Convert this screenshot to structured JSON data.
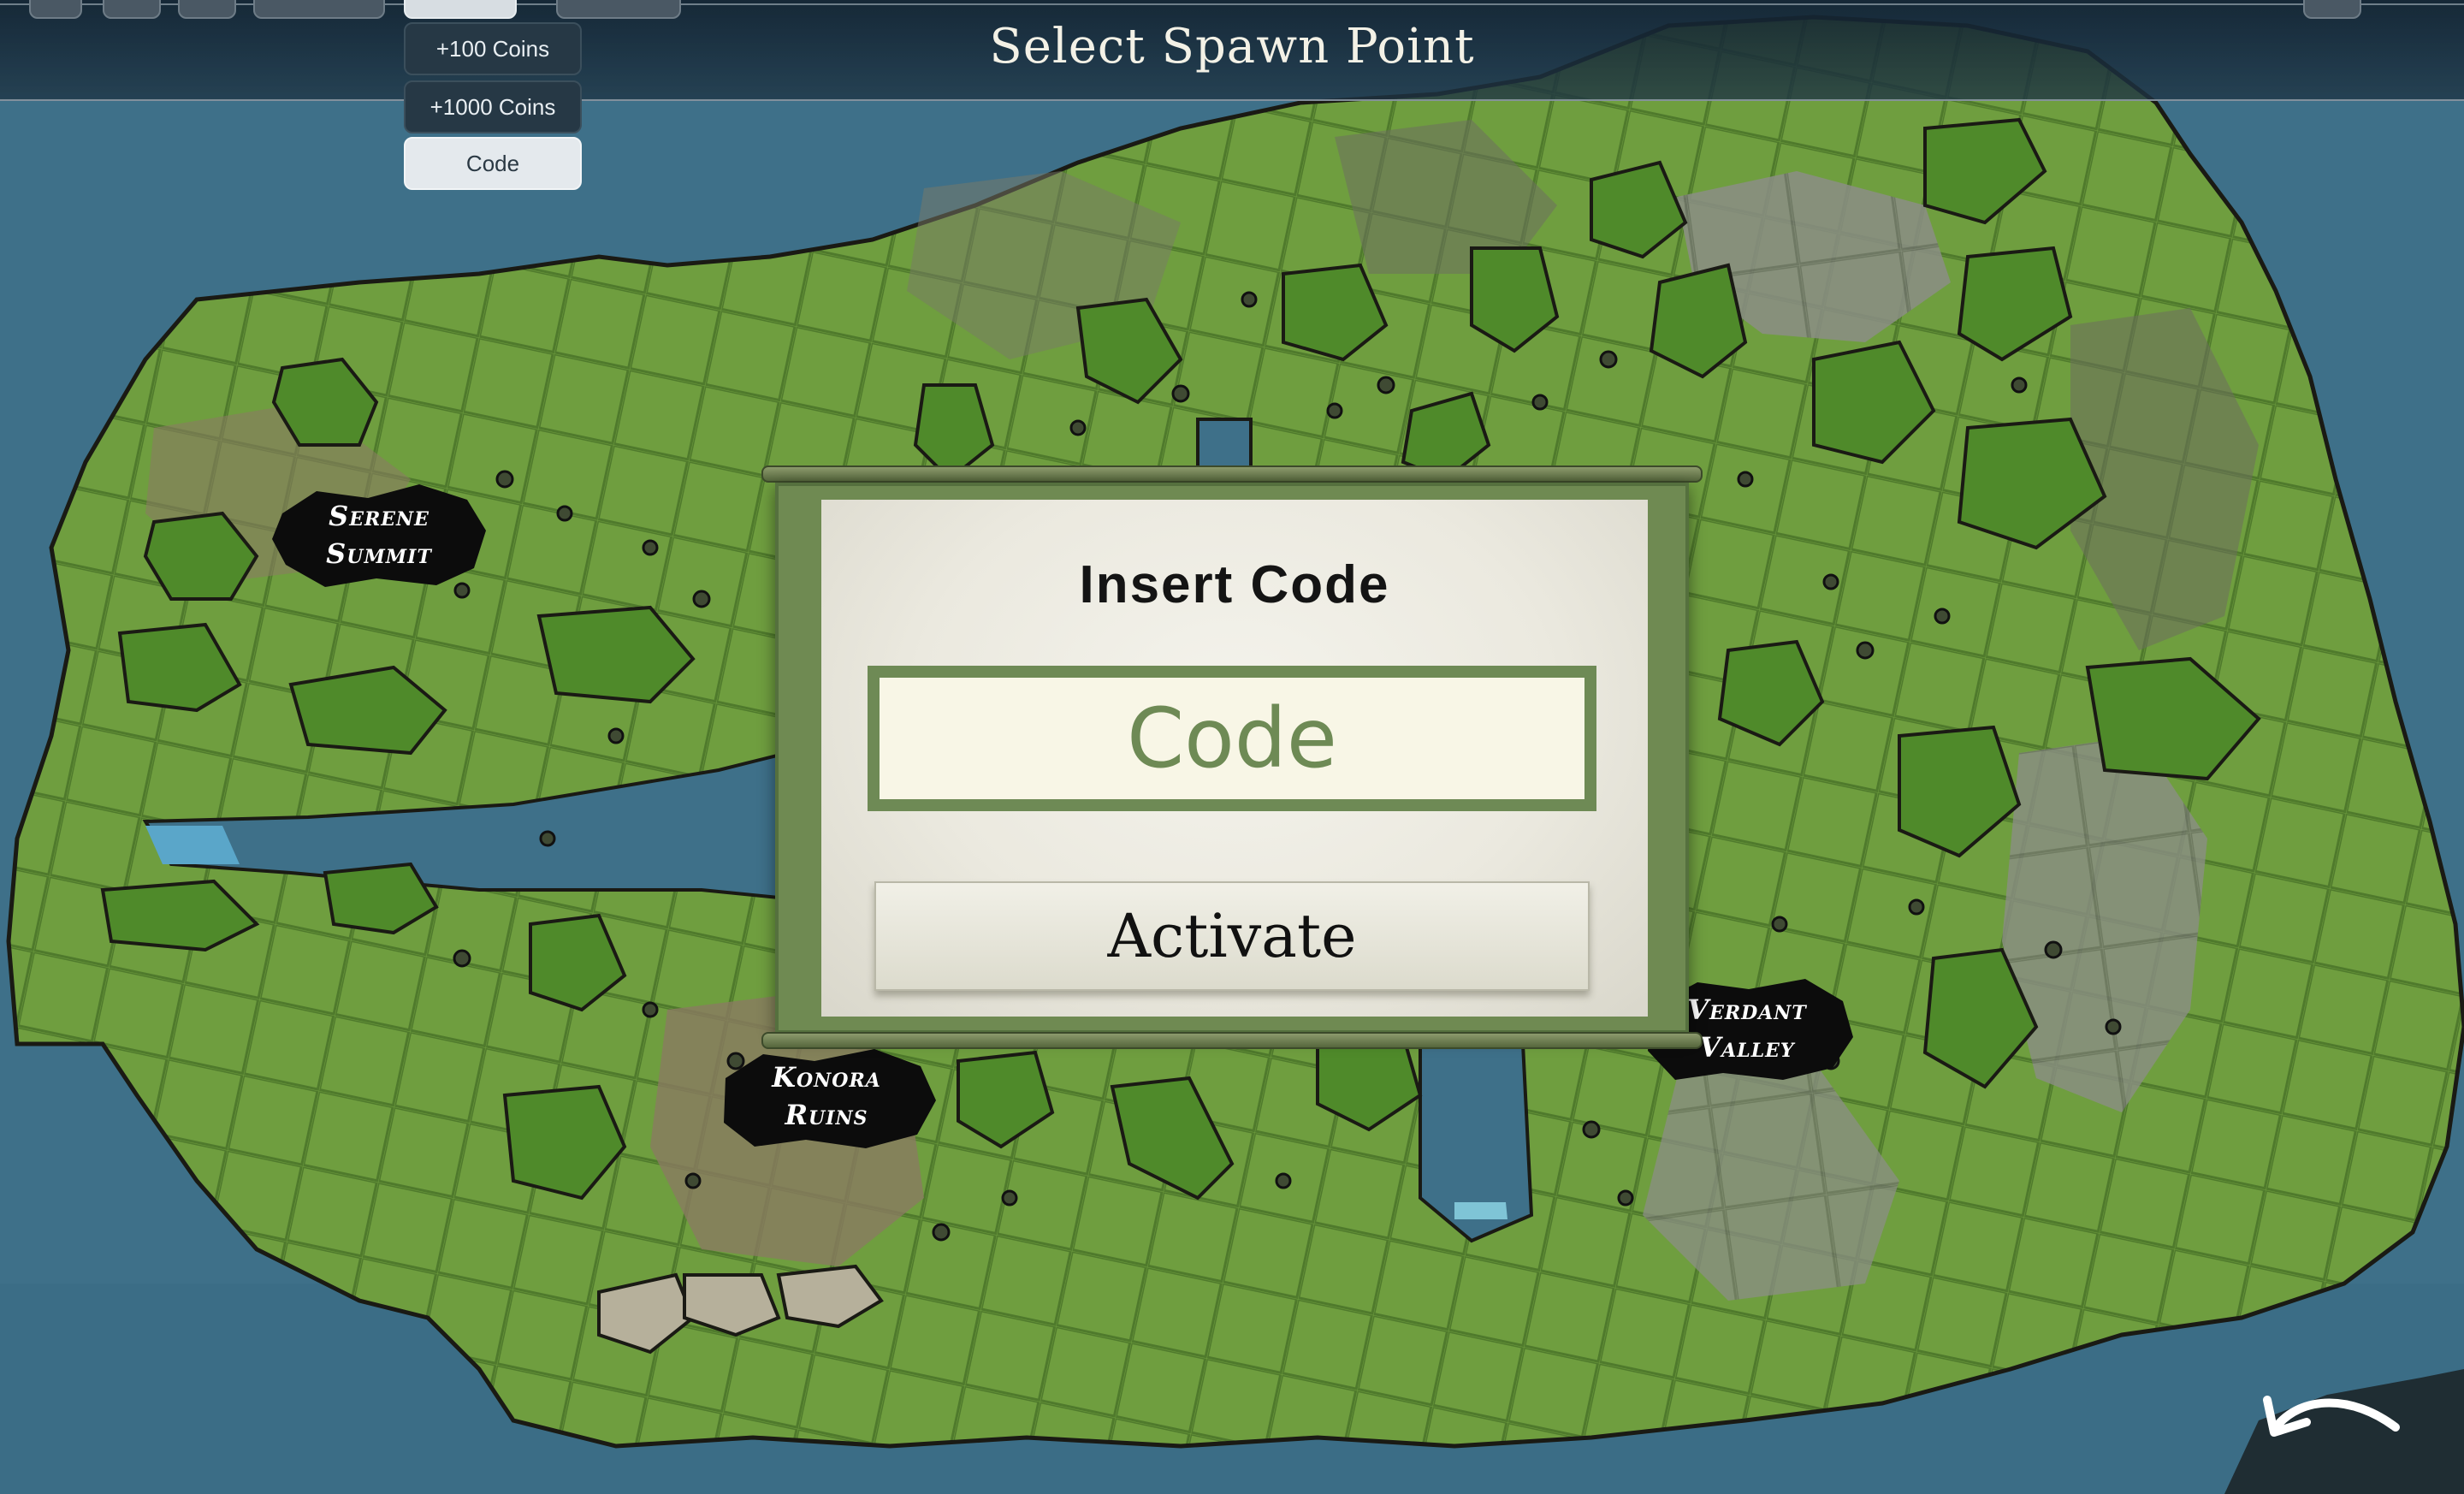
{
  "header": {
    "title": "Select Spawn Point"
  },
  "dev_menu": {
    "items": [
      {
        "label": "+100 Coins",
        "selected": false
      },
      {
        "label": "+1000 Coins",
        "selected": false
      },
      {
        "label": "Code",
        "selected": true
      }
    ]
  },
  "locations": [
    {
      "label": "Serene\nSummit"
    },
    {
      "label": "Konora\nRuins"
    },
    {
      "label": "Verdant\nValley"
    }
  ],
  "code_dialog": {
    "title": "Insert Code",
    "input_placeholder": "Code",
    "input_value": "",
    "activate_label": "Activate"
  },
  "icons": {
    "back": "back-arrow-icon"
  },
  "colors": {
    "ocean": "#3d6f86",
    "land": "#6a9a3c",
    "dialog_green": "#6e8a55",
    "top_bar": "#1e3444"
  }
}
